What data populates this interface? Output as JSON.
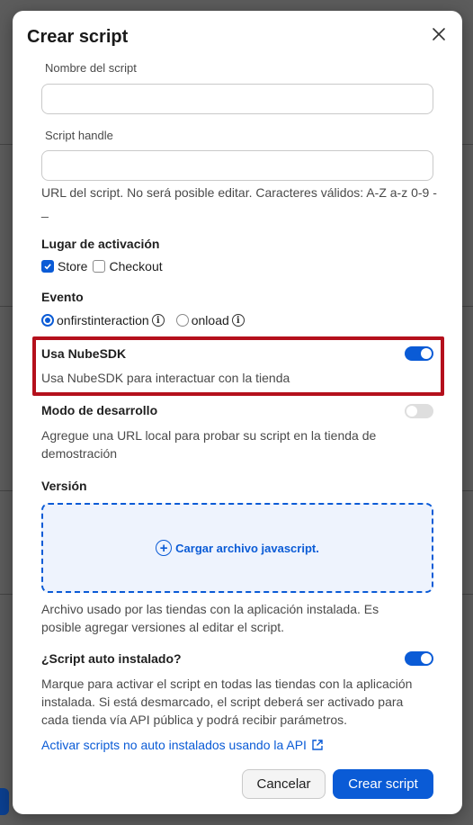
{
  "modal": {
    "title": "Crear script",
    "script_name_label": "Nombre del script",
    "script_name_value": "",
    "handle_label": "Script handle",
    "handle_value": "",
    "handle_help": "URL del script. No será posible editar. Caracteres válidos: A-Z a-z 0-9 - _",
    "activation": {
      "title": "Lugar de activación",
      "options": [
        {
          "label": "Store",
          "checked": true
        },
        {
          "label": "Checkout",
          "checked": false
        }
      ]
    },
    "event": {
      "title": "Evento",
      "options": [
        {
          "label": "onfirstinteraction",
          "selected": true
        },
        {
          "label": "onload",
          "selected": false
        }
      ]
    },
    "nubesdk": {
      "title": "Usa NubeSDK",
      "help": "Usa NubeSDK para interactuar con la tienda",
      "enabled": true
    },
    "dev_mode": {
      "title": "Modo de desarrollo",
      "help": "Agregue una URL local para probar su script en la tienda de demostración",
      "enabled": false
    },
    "version": {
      "title": "Versión",
      "upload_label": "Cargar archivo javascript.",
      "help": "Archivo usado por las tiendas con la aplicación instalada. Es posible agregar versiones al editar el script."
    },
    "auto_install": {
      "title": "¿Script auto instalado?",
      "help": "Marque para activar el script en todas las tiendas con la aplicación instalada. Si está desmarcado, el script deberá ser activado para cada tienda vía API pública y podrá recibir parámetros.",
      "enabled": true,
      "link": "Activar scripts no auto instalados usando la API"
    },
    "buttons": {
      "cancel": "Cancelar",
      "create": "Crear script"
    }
  },
  "colors": {
    "accent": "#0a5bd6",
    "highlight": "#b4101c",
    "overlay": "#5c5c5c"
  }
}
